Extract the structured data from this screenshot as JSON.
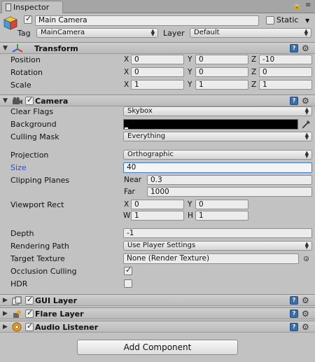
{
  "tab": {
    "title": "Inspector"
  },
  "object": {
    "name": "Main Camera",
    "active": true,
    "static_label": "Static",
    "static": false,
    "tag_label": "Tag",
    "tag": "MainCamera",
    "layer_label": "Layer",
    "layer": "Default"
  },
  "transform": {
    "title": "Transform",
    "expanded": true,
    "rows": [
      {
        "label": "Position",
        "x": "0",
        "y": "0",
        "z": "-10"
      },
      {
        "label": "Rotation",
        "x": "0",
        "y": "0",
        "z": "0"
      },
      {
        "label": "Scale",
        "x": "1",
        "y": "1",
        "z": "1"
      }
    ],
    "axis": {
      "x": "X",
      "y": "Y",
      "z": "Z"
    }
  },
  "camera": {
    "title": "Camera",
    "enabled": true,
    "clear_flags_label": "Clear Flags",
    "clear_flags": "Skybox",
    "background_label": "Background",
    "background_color": "#000000",
    "culling_mask_label": "Culling Mask",
    "culling_mask": "Everything",
    "projection_label": "Projection",
    "projection": "Orthographic",
    "size_label": "Size",
    "size": "40",
    "clipping_label": "Clipping Planes",
    "near_label": "Near",
    "near": "0.3",
    "far_label": "Far",
    "far": "1000",
    "viewport_label": "Viewport Rect",
    "viewport": {
      "x_label": "X",
      "x": "0",
      "y_label": "Y",
      "y": "0",
      "w_label": "W",
      "w": "1",
      "h_label": "H",
      "h": "1"
    },
    "depth_label": "Depth",
    "depth": "-1",
    "rendering_path_label": "Rendering Path",
    "rendering_path": "Use Player Settings",
    "target_texture_label": "Target Texture",
    "target_texture": "None (Render Texture)",
    "occlusion_label": "Occlusion Culling",
    "occlusion": true,
    "hdr_label": "HDR",
    "hdr": false
  },
  "components": [
    {
      "title": "GUI Layer",
      "enabled": true
    },
    {
      "title": "Flare Layer",
      "enabled": true
    },
    {
      "title": "Audio Listener",
      "enabled": true
    }
  ],
  "add_component": "Add Component",
  "colors": {
    "highlight_label": "#2451c9",
    "focus_border": "#3d7bd9",
    "help_icon": "#3b6ea8"
  }
}
